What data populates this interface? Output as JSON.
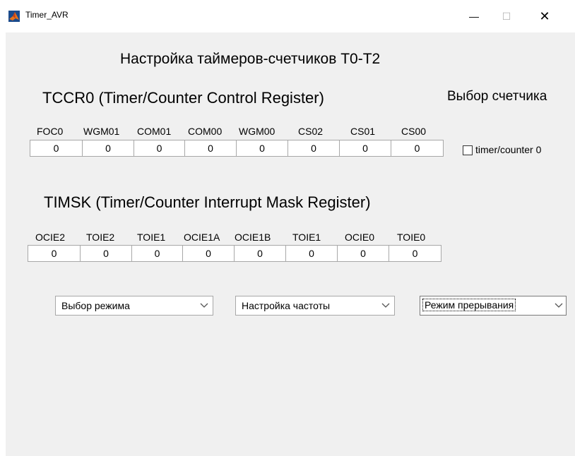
{
  "window": {
    "title": "Timer_AVR",
    "min_label": "—",
    "max_label": "☐",
    "close_label": "✕"
  },
  "heading": "Настройка таймеров-счетчиков T0-T2",
  "tccr0": {
    "title": "TCCR0 (Timer/Counter Control Register)",
    "bits": [
      {
        "label": "FOC0",
        "value": "0"
      },
      {
        "label": "WGM01",
        "value": "0"
      },
      {
        "label": "COM01",
        "value": "0"
      },
      {
        "label": "COM00",
        "value": "0"
      },
      {
        "label": "WGM00",
        "value": "0"
      },
      {
        "label": "CS02",
        "value": "0"
      },
      {
        "label": "CS01",
        "value": "0"
      },
      {
        "label": "CS00",
        "value": "0"
      }
    ]
  },
  "counter_select": {
    "title": "Выбор счетчика",
    "checkbox_label": "timer/counter 0",
    "checked": false
  },
  "timsk": {
    "title": "TIMSK (Timer/Counter Interrupt Mask Register)",
    "bits": [
      {
        "label": "OCIE2",
        "value": "0"
      },
      {
        "label": "TOIE2",
        "value": "0"
      },
      {
        "label": "TOIE1",
        "value": "0"
      },
      {
        "label": "OCIE1A",
        "value": "0"
      },
      {
        "label": "OCIE1B",
        "value": "0"
      },
      {
        "label": "TOIE1",
        "value": "0"
      },
      {
        "label": "OCIE0",
        "value": "0"
      },
      {
        "label": "TOIE0",
        "value": "0"
      }
    ]
  },
  "dropdowns": {
    "mode": "Выбор режима",
    "frequency": "Настройка частоты",
    "interrupt": "Режим прерывания"
  },
  "colors": {
    "figure_bg": "#f0f0f0",
    "field_border": "#a8a8a8",
    "icon_orange": "#e8731a"
  }
}
